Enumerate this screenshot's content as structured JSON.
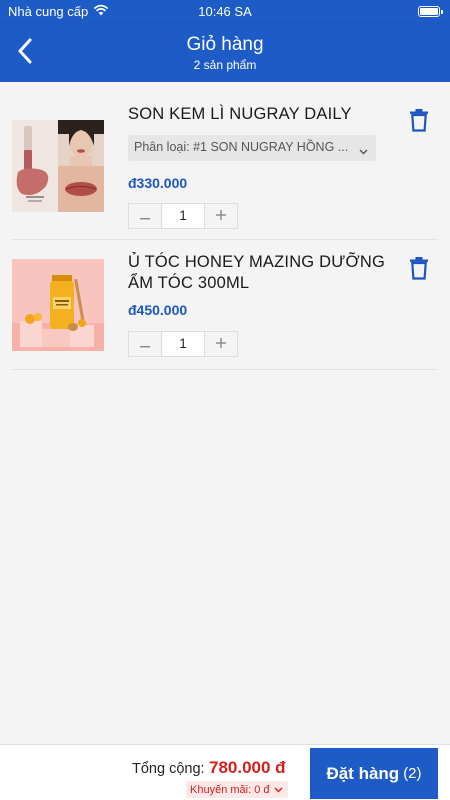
{
  "status_bar": {
    "carrier": "Nhà cung cấp",
    "time": "10:46 SA",
    "icons": [
      "wifi-icon",
      "battery-icon"
    ]
  },
  "header": {
    "back_icon": "chevron-left-icon",
    "title": "Giỏ hàng",
    "subtitle": "2 sản phẩm"
  },
  "cart": {
    "items": [
      {
        "name": "SON  KEM LÌ NUGRAY DAILY",
        "variant": "Phân loại: #1 SON NUGRAY HỒNG ...",
        "price": "đ330.000",
        "quantity": "1",
        "image": "lipstick-product-image"
      },
      {
        "name": "Ủ TÓC HONEY MAZING DƯỠNG ẨM TÓC 300ML",
        "price": "đ450.000",
        "quantity": "1",
        "image": "honey-hair-mask-product-image"
      }
    ]
  },
  "footer": {
    "total_label": "Tổng cộng:",
    "total_value": "780.000 đ",
    "promo_label": "Khuyến mãi: 0 đ",
    "order_label": "Đặt hàng",
    "order_count": "(2)"
  },
  "colors": {
    "primary": "#1d5bc7",
    "price": "#1d56c0",
    "total": "#d62020",
    "background": "#f4f4f4"
  }
}
